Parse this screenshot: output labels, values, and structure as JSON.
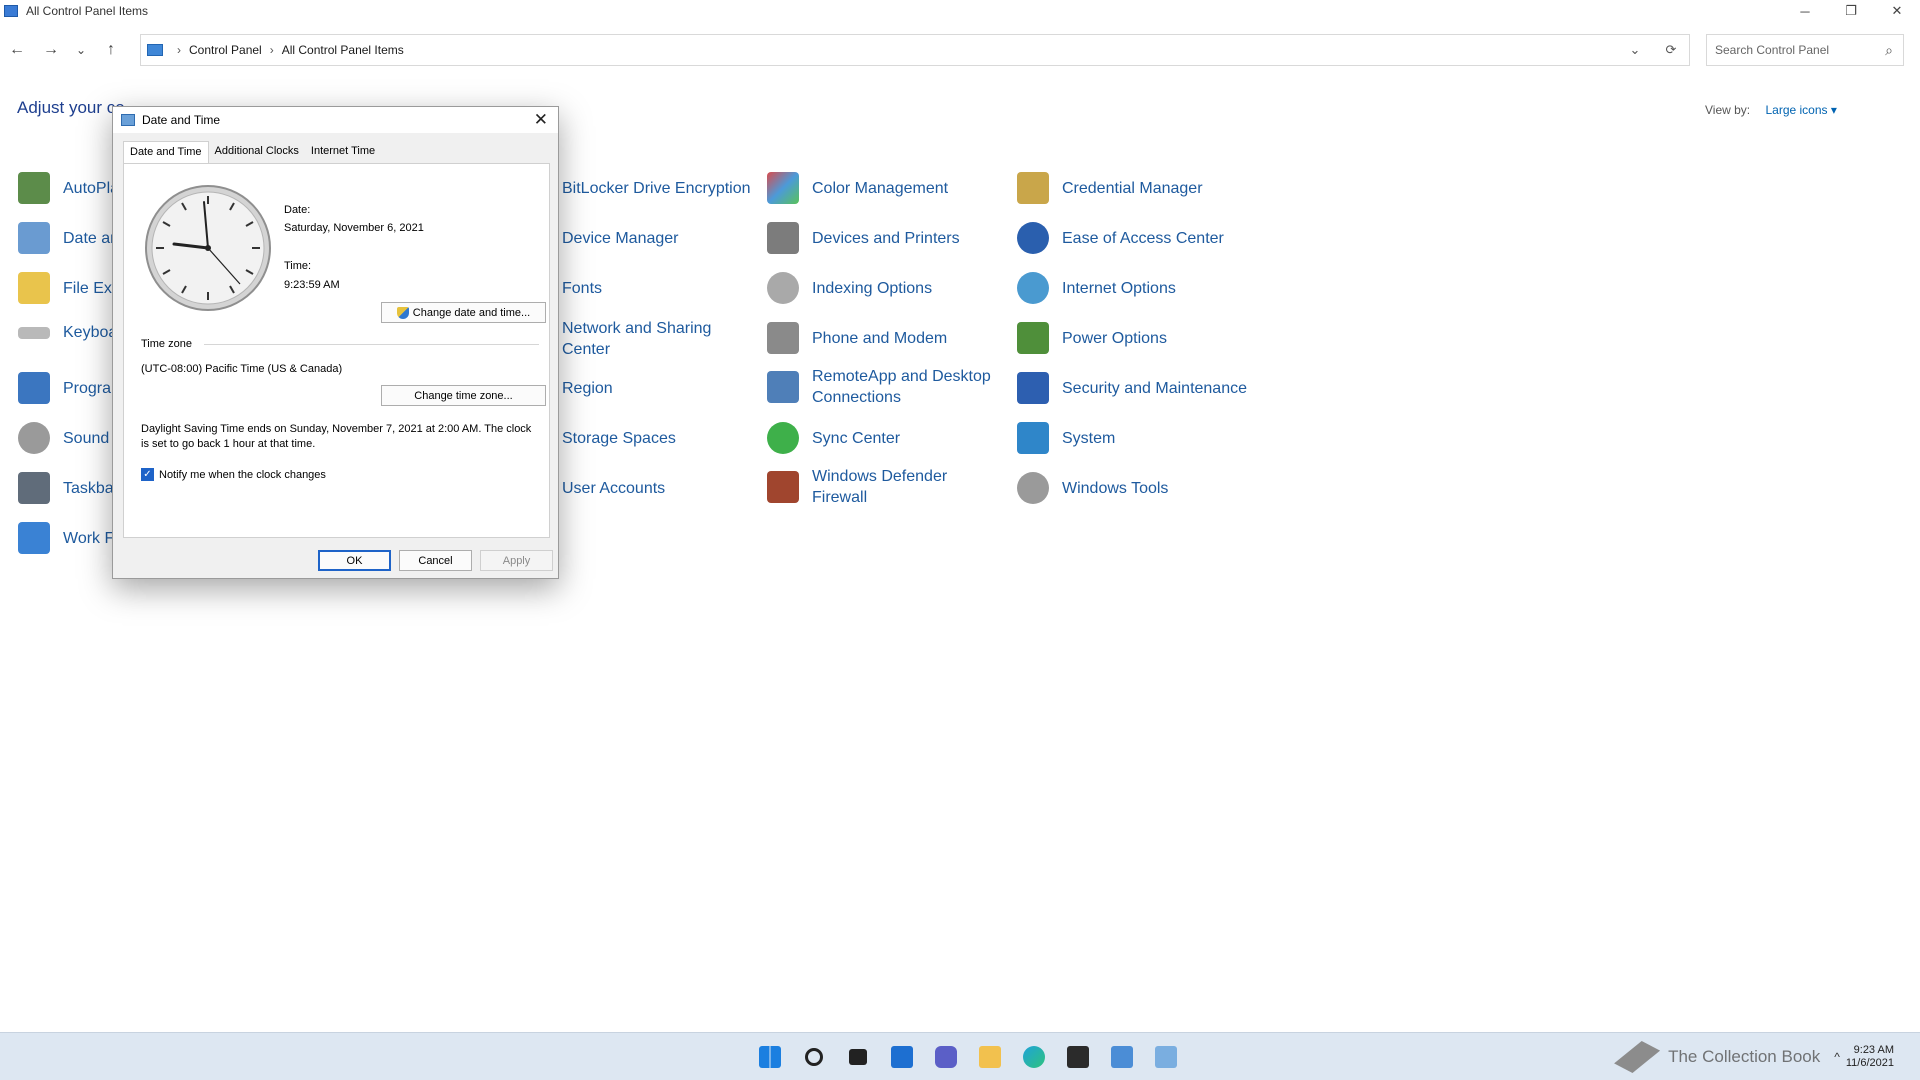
{
  "window": {
    "title": "All Control Panel Items",
    "minimize_label": "─",
    "restore_label": "❐",
    "close_label": "✕"
  },
  "nav": {
    "back": "←",
    "forward": "→",
    "recent": "⌄",
    "up": "↑",
    "breadcrumb": [
      "Control Panel",
      "All Control Panel Items"
    ],
    "breadcrumb_sep": "›",
    "dropdown": "⌄",
    "refresh": "⟳",
    "search_placeholder": "Search Control Panel",
    "search_icon": "⌕"
  },
  "header": {
    "title": "Adjust your co",
    "view_by_label": "View by:",
    "view_by_value": "Large icons ▾"
  },
  "items": {
    "col1": [
      "AutoPla",
      "Date ar",
      "File Exp",
      "Keyboa",
      "Prograi",
      "Sound",
      "Taskbar",
      "Work Fi"
    ],
    "col2": [
      "BitLocker Drive Encryption",
      "Device Manager",
      "Fonts",
      "Network and Sharing Center",
      "Region",
      "Storage Spaces",
      "User Accounts"
    ],
    "col3": [
      "Color Management",
      "Devices and Printers",
      "Indexing Options",
      "Phone and Modem",
      "RemoteApp and Desktop Connections",
      "Sync Center",
      "Windows Defender Firewall"
    ],
    "col4": [
      "Credential Manager",
      "Ease of Access Center",
      "Internet Options",
      "Power Options",
      "Security and Maintenance",
      "System",
      "Windows Tools"
    ]
  },
  "dialog": {
    "title": "Date and Time",
    "close": "✕",
    "tabs": [
      "Date and Time",
      "Additional Clocks",
      "Internet Time"
    ],
    "date_label": "Date:",
    "date_value": "Saturday, November 6, 2021",
    "time_label": "Time:",
    "time_value": "9:23:59 AM",
    "change_dt_button": "Change date and time...",
    "timezone_label": "Time zone",
    "timezone_value": "(UTC-08:00) Pacific Time (US & Canada)",
    "change_tz_button": "Change time zone...",
    "dst_text": "Daylight Saving Time ends on Sunday, November 7, 2021 at 2:00 AM. The clock is set to go back 1 hour at that time.",
    "notify_label": "Notify me when the clock changes",
    "notify_checked": "✓",
    "ok": "OK",
    "cancel": "Cancel",
    "apply": "Apply"
  },
  "taskbar": {
    "watermark": "The Collection Book",
    "tray_clock_time": "9:23 AM",
    "tray_clock_date": "11/6/2021",
    "tray_chevron": "^"
  },
  "colors": {
    "link": "#1e5a9e",
    "header": "#1e3f8f",
    "accent": "#1e63c8",
    "taskbar": "#dde7f2"
  }
}
